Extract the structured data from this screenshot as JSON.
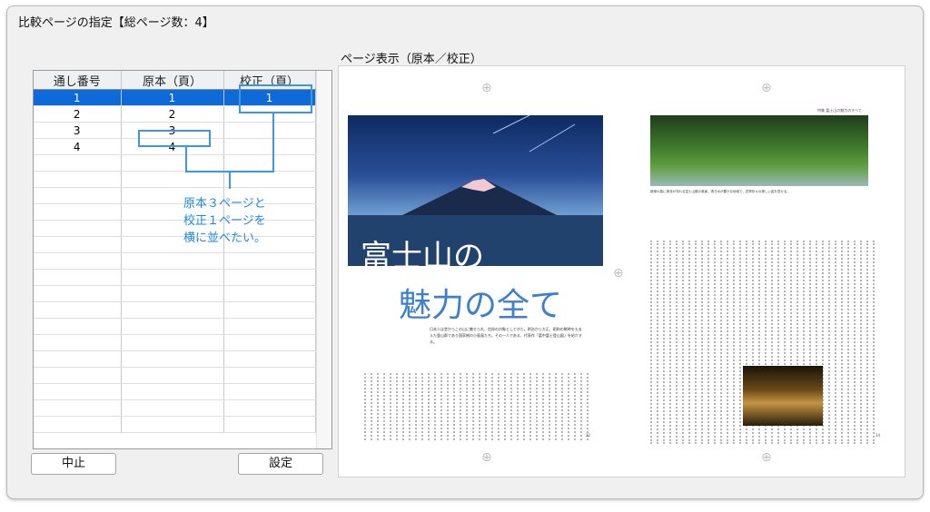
{
  "dialog": {
    "title": "比較ページの指定【総ページ数：4】"
  },
  "table": {
    "headers": [
      "通し番号",
      "原本（頁）",
      "校正（頁）"
    ],
    "rows": [
      [
        "1",
        "1",
        "1"
      ],
      [
        "2",
        "2",
        ""
      ],
      [
        "3",
        "3",
        ""
      ],
      [
        "4",
        "4",
        ""
      ]
    ],
    "selected_row": 0,
    "empty_rows": 17
  },
  "buttons": {
    "cancel": "中止",
    "ok": "設定"
  },
  "preview": {
    "label": "ページ表示（原本／校正）",
    "left_page": {
      "title_line1": "富士山の",
      "title_line2": "魅力の全て",
      "lead": "日本人は昔からこの山に魅せられ、信仰の対象としてきた。明治から大正、昭和の戦時をも支えた霊山群であり国家樹の小島島たち。その一人である、代表作「富中富士登山図」を紹介する。",
      "page_number": "22"
    },
    "right_page": {
      "header": "特集 富士山の魅力のすべて",
      "caption": "新緑の森に清流が流れる富士山麓の風景。湧き水が豊かな地域で、四季折々の美しい姿を見せる。",
      "page_number": "24"
    }
  },
  "annotation": {
    "lines": [
      "原本３ページと",
      "校正１ページを",
      "横に並べたい。"
    ]
  },
  "colors": {
    "selection": "#0f6ad9",
    "callout": "#3d97e0"
  }
}
